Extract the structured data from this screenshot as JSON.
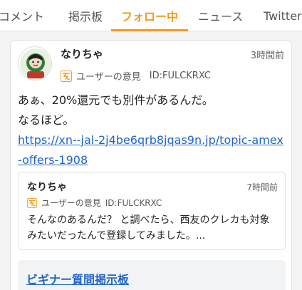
{
  "tabs": [
    {
      "label": "コメント"
    },
    {
      "label": "掲示板"
    },
    {
      "label": "フォロー中"
    },
    {
      "label": "ニュース"
    },
    {
      "label": "Twitter"
    }
  ],
  "active_tab_index": 2,
  "colors": {
    "accent": "#f39a1e",
    "link": "#1e65c8"
  },
  "post": {
    "author": "なりちゃ",
    "time": "3時間前",
    "category": "ユーザーの意見",
    "user_id": "ID:FULCKRXC",
    "text_line1": "あぁ、20%還元でも別件があるんだ。",
    "text_line2": "なるほど。",
    "link_line1": "https://xn--jal-2j4be6qrb8jqas9n.jp/topic-amex",
    "link_line2": "-offers-1908"
  },
  "quote": {
    "author": "なりちゃ",
    "time": "7時間前",
    "category": "ユーザーの意見",
    "user_id": "ID:FULCKRXC",
    "text": "そんなのあるんだ？ と調べたら、西友のクレカも対象みたいだったんで登録してみました。..."
  },
  "board_link": "ビギナー質問掲示板",
  "icons": {
    "avatar": "avatar-image",
    "category": "opinion-icon"
  }
}
